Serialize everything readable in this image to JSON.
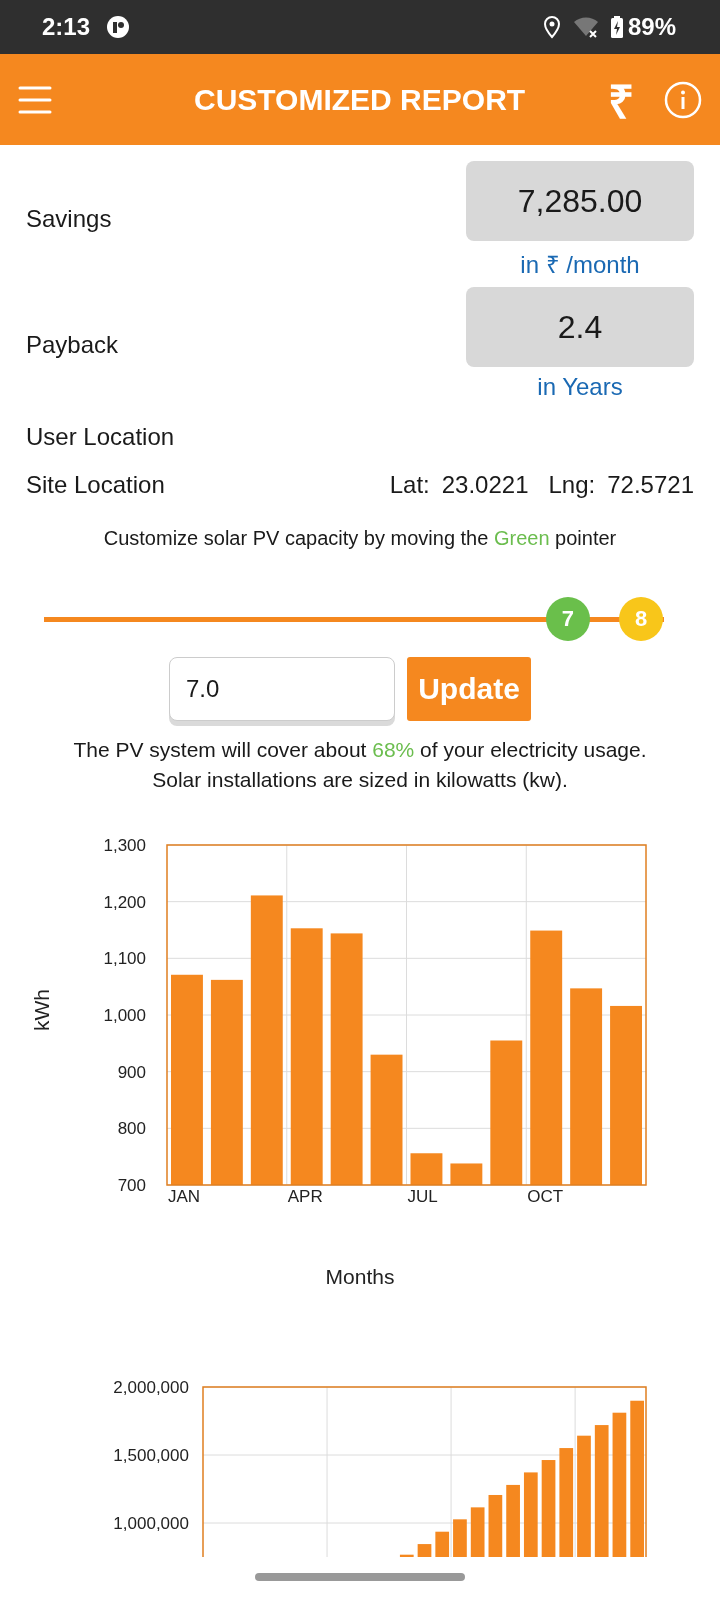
{
  "status_bar": {
    "time": "2:13",
    "battery": "89%"
  },
  "app_bar": {
    "title": "CUSTOMIZED REPORT",
    "currency_symbol": "₹"
  },
  "metrics": [
    {
      "label": "Savings",
      "value": "7,285.00",
      "unit": "in ₹ /month"
    },
    {
      "label": "Payback",
      "value": "2.4",
      "unit": "in Years"
    }
  ],
  "user_location": {
    "label": "User Location"
  },
  "site_location": {
    "label": "Site Location",
    "lat_label": "Lat:",
    "lat": "23.0221",
    "lng_label": "Lng:",
    "lng": "72.5721"
  },
  "instruction": {
    "before": "Customize solar PV capacity by moving the ",
    "highlight": "Green",
    "after": " pointer"
  },
  "slider": {
    "level": 0.845,
    "pointer_label": "7",
    "limit_marker": {
      "label": "8",
      "level": 0.963
    }
  },
  "capacity_input": {
    "value": "7.0"
  },
  "update_button": "Update",
  "coverage": {
    "before": "The PV system will cover about ",
    "highlight": "68%",
    "after": " of your electricity usage."
  },
  "note": "Solar installations are sized in kilowatts (kw).",
  "monthly_chart": {
    "chart_data": {
      "type": "bar",
      "grid": true,
      "xlabel": "Months",
      "ylabel": "kWh",
      "categories": [
        "JAN",
        null,
        null,
        "APR",
        null,
        null,
        "JUL",
        null,
        null,
        "OCT",
        null,
        null
      ],
      "ylim": [
        700,
        1300
      ],
      "yticks": [
        {
          "value": 700,
          "label": "700"
        },
        {
          "value": 800,
          "label": "800"
        },
        {
          "value": 900,
          "label": "900"
        },
        {
          "value": 1000,
          "label": "1,000"
        },
        {
          "value": 1100,
          "label": "1,100"
        },
        {
          "value": 1200,
          "label": "1,200"
        },
        {
          "value": 1300,
          "label": "1,300"
        }
      ],
      "values": [
        1071,
        1062,
        1211,
        1153,
        1144,
        930,
        756,
        738,
        955,
        1149,
        1047,
        1016
      ]
    }
  },
  "cumulative_chart": {
    "chart_data": {
      "type": "bar",
      "grid": true,
      "ylim": [
        750000,
        2000000
      ],
      "yticks": [
        {
          "value": 1000000,
          "label": "1,000,000"
        },
        {
          "value": 1500000,
          "label": "1,500,000"
        },
        {
          "value": 2000000,
          "label": "2,000,000"
        }
      ],
      "values": [
        null,
        null,
        null,
        null,
        null,
        null,
        null,
        null,
        null,
        null,
        null,
        767000,
        845000,
        936000,
        1027000,
        1115000,
        1206000,
        1280000,
        1372000,
        1463000,
        1551000,
        1642000,
        1720000,
        1811000,
        1899000
      ]
    }
  }
}
